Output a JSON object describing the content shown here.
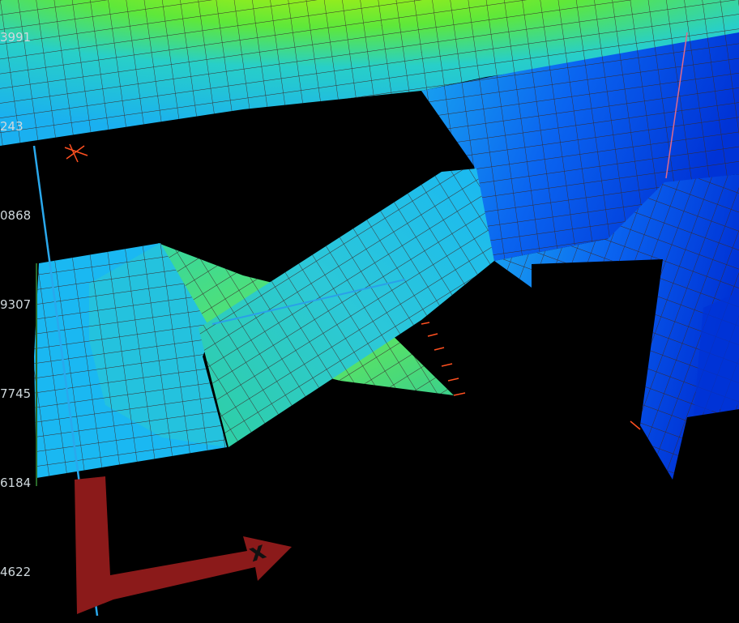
{
  "viewport": {
    "name": "fea-mesh-viewport"
  },
  "legend": {
    "labels": [
      "3991",
      "243",
      "0868",
      "9307",
      "7745",
      "6184",
      "4622"
    ]
  },
  "axis": {
    "x_label": "x"
  },
  "colors": {
    "background": "#000000",
    "mesh_high": "#8cf000",
    "mesh_mid": "#3bdc8c",
    "mesh_cyan": "#1ab8f2",
    "mesh_blue": "#0a64f0",
    "mesh_deep": "#0033d6",
    "axis_arrow": "#8b1a1a",
    "grid_line": "#3a2a2a"
  }
}
